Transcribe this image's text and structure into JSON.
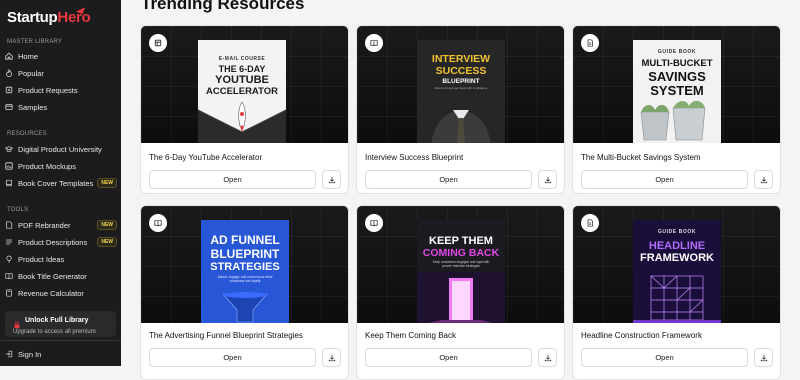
{
  "brand": {
    "part1": "Startup",
    "part2": "Hero"
  },
  "page_title": "Trending Resources",
  "sidebar": {
    "sections": [
      {
        "title": "MASTER LIBRARY",
        "items": [
          {
            "label": "Home",
            "icon": "home-icon"
          },
          {
            "label": "Popular",
            "icon": "flame-icon"
          },
          {
            "label": "Product Requests",
            "icon": "request-icon"
          },
          {
            "label": "Samples",
            "icon": "samples-icon"
          }
        ]
      },
      {
        "title": "RESOURCES",
        "items": [
          {
            "label": "Digital Product University",
            "icon": "graduation-cap-icon"
          },
          {
            "label": "Product Mockups",
            "icon": "mockup-icon"
          },
          {
            "label": "Book Cover Templates",
            "icon": "book-icon",
            "badge": "NEW"
          }
        ]
      },
      {
        "title": "TOOLS",
        "items": [
          {
            "label": "PDF Rebrander",
            "icon": "pdf-icon",
            "badge": "NEW"
          },
          {
            "label": "Product Descriptions",
            "icon": "description-icon",
            "badge": "NEW"
          },
          {
            "label": "Product Ideas",
            "icon": "lightbulb-icon"
          },
          {
            "label": "Book Title Generator",
            "icon": "book-open-icon"
          },
          {
            "label": "Revenue Calculator",
            "icon": "calculator-icon"
          }
        ]
      }
    ],
    "unlock": {
      "title": "Unlock Full Library",
      "subtitle": "Upgrade to access all premium"
    },
    "signin": "Sign In"
  },
  "cards": [
    {
      "title": "The 6-Day YouTube Accelerator",
      "type_icon": "layout-icon",
      "open": "Open",
      "cover": {
        "kicker": "E-MAIL COURSE",
        "l1": "THE 6-DAY",
        "l2": "YOUTUBE",
        "l3": "ACCELERATOR",
        "bg": "#f3f3f3",
        "fg": "#1a1a1a"
      }
    },
    {
      "title": "Interview Success Blueprint",
      "type_icon": "book-open-icon",
      "open": "Open",
      "cover": {
        "l1": "INTERVIEW",
        "l2": "SUCCESS",
        "l3": "BLUEPRINT",
        "sub": "Stand out and get hired with confidence",
        "bg": "#2a2a2a",
        "fg": "#f2c230"
      }
    },
    {
      "title": "The Multi-Bucket Savings System",
      "type_icon": "document-icon",
      "open": "Open",
      "cover": {
        "kicker": "GUIDE BOOK",
        "l1": "MULTI-BUCKET",
        "l2": "SAVINGS",
        "l3": "SYSTEM",
        "bg": "#f2f2f2",
        "fg": "#111111"
      }
    },
    {
      "title": "The Advertising Funnel Blueprint Strategies",
      "type_icon": "book-open-icon",
      "open": "Open",
      "cover": {
        "l1": "AD FUNNEL",
        "l2": "BLUEPRINT",
        "l3": "STRATEGIES",
        "sub": "Attract, engage, and convert your ideal customers into loyalty",
        "bg": "#2756d6",
        "fg": "#ffffff"
      }
    },
    {
      "title": "Keep Them Coming Back",
      "type_icon": "book-open-icon",
      "open": "Open",
      "cover": {
        "l1": "KEEP THEM",
        "l2": "COMING BACK",
        "sub": "Keep customers engaged and loyal with proven retention strategies",
        "bg": "#1b1b22",
        "fg": "#ffffff",
        "accent": "#e048e6"
      }
    },
    {
      "title": "Headline Construction Framework",
      "type_icon": "document-icon",
      "open": "Open",
      "cover": {
        "kicker": "GUIDE BOOK",
        "l1": "HEADLINE",
        "l2": "FRAMEWORK",
        "bg": "#1a0f3a",
        "fg": "#ffffff",
        "accent": "#a54bff"
      }
    }
  ]
}
